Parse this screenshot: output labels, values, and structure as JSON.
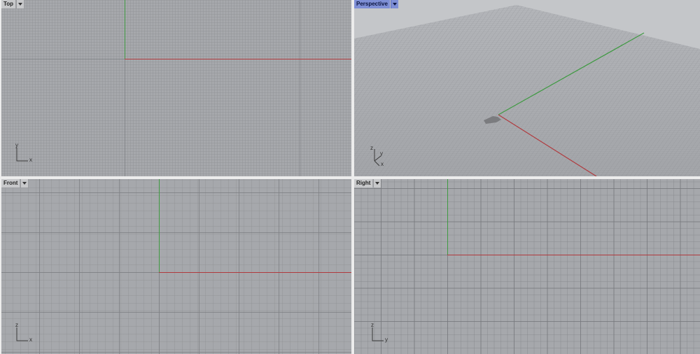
{
  "viewports": {
    "top": {
      "title": "Top",
      "triad": {
        "v": "y",
        "h": "x"
      }
    },
    "perspective": {
      "title": "Perspective",
      "active": true,
      "triad": {
        "a": "z",
        "b": "y",
        "c": "x"
      }
    },
    "front": {
      "title": "Front",
      "triad": {
        "v": "z",
        "h": "x"
      }
    },
    "right": {
      "title": "Right",
      "triad": {
        "v": "z",
        "h": "y"
      }
    }
  },
  "colors": {
    "viewport_bg": "#a6a8ac",
    "x_axis": "#b03a3e",
    "y_axis": "#3f9a42",
    "active_tab": "#7e8fd6"
  },
  "icons": {
    "dropdown": "triangle-down-icon"
  }
}
